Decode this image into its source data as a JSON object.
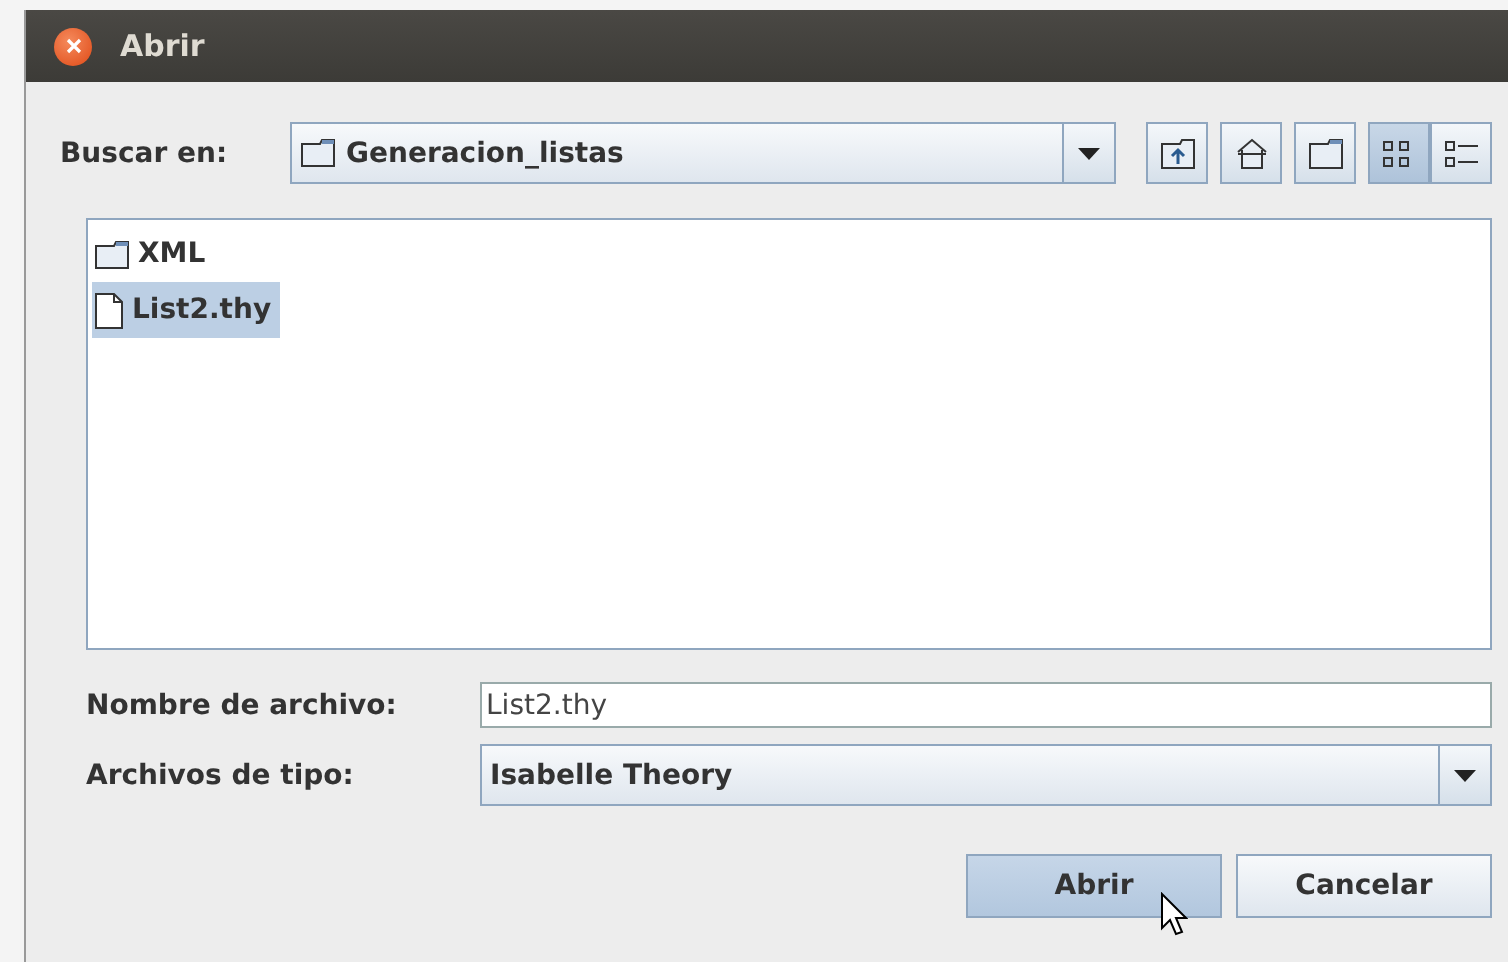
{
  "window": {
    "title": "Abrir"
  },
  "look_in": {
    "label": "Buscar en:",
    "value": "Generacion_listas"
  },
  "toolbar": [
    {
      "kind": "up",
      "selected": false
    },
    {
      "kind": "home",
      "selected": false
    },
    {
      "kind": "new-folder",
      "selected": false
    },
    {
      "kind": "list-view",
      "selected": true
    },
    {
      "kind": "details-view",
      "selected": false
    }
  ],
  "files": [
    {
      "name": "XML",
      "kind": "folder",
      "selected": false
    },
    {
      "name": "List2.thy",
      "kind": "file",
      "selected": true
    }
  ],
  "file_name": {
    "label": "Nombre de archivo:",
    "value": "List2.thy"
  },
  "file_type": {
    "label": "Archivos de tipo:",
    "value": "Isabelle Theory"
  },
  "buttons": [
    {
      "label": "Abrir",
      "default": true
    },
    {
      "label": "Cancelar",
      "default": false
    }
  ]
}
